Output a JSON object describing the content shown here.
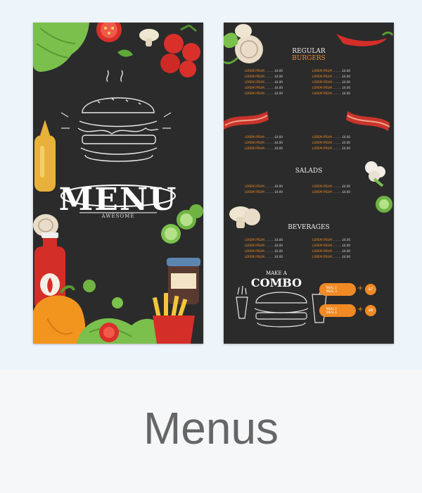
{
  "card": {
    "label": "Menus"
  },
  "left_panel": {
    "title": "MENU",
    "subtitle": "AWESOME"
  },
  "right_panel": {
    "sections": [
      {
        "title_line1": "REGULAR",
        "title_line2": "BURGERS"
      },
      {
        "title_line1": "SALADS"
      },
      {
        "title_line1": "BEVERAGES"
      }
    ],
    "item_text": "LOREM IPSUM",
    "item_price": "£4.00",
    "combo": {
      "line1": "MAKE A",
      "line2": "COMBO",
      "deals": [
        {
          "item1": "MEAL 1",
          "item2": "MEAL 3",
          "price": "$7"
        },
        {
          "item1": "MEAL 2",
          "item2": "MEAL 4",
          "price": "$8"
        }
      ]
    }
  },
  "colors": {
    "panel_background": "#2b2b2b",
    "accent": "#f08a24",
    "label_text": "#666666",
    "page_background": "#f6f7f8"
  },
  "illustrations": [
    "lettuce-icon",
    "tomato-icon",
    "mushroom-icon",
    "burger-icon",
    "mustard-bottle-icon",
    "ketchup-bottle-icon",
    "onion-icon",
    "cucumber-icon",
    "jar-icon",
    "fries-icon",
    "pepper-icon",
    "chili-icon",
    "bacon-icon",
    "cauliflower-icon"
  ]
}
